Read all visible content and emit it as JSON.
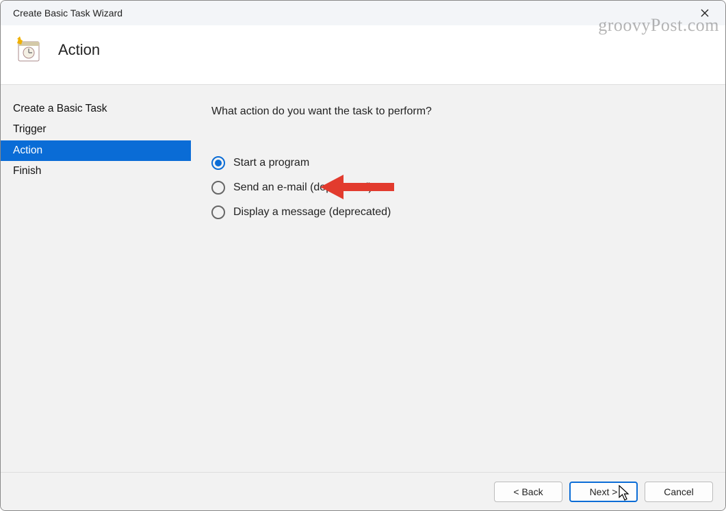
{
  "titlebar": {
    "title": "Create Basic Task Wizard"
  },
  "header": {
    "title": "Action"
  },
  "sidebar": {
    "items": [
      {
        "label": "Create a Basic Task",
        "selected": false
      },
      {
        "label": "Trigger",
        "selected": false
      },
      {
        "label": "Action",
        "selected": true
      },
      {
        "label": "Finish",
        "selected": false
      }
    ]
  },
  "main": {
    "prompt": "What action do you want the task to perform?",
    "options": [
      {
        "label": "Start a program",
        "checked": true
      },
      {
        "label": "Send an e-mail (deprecated)",
        "checked": false
      },
      {
        "label": "Display a message (deprecated)",
        "checked": false
      }
    ]
  },
  "buttons": {
    "back": "< Back",
    "next": "Next >",
    "cancel": "Cancel"
  },
  "watermark": "groovyPost.com",
  "colors": {
    "accent": "#0a6cd6",
    "annotation": "#e23b2e"
  }
}
